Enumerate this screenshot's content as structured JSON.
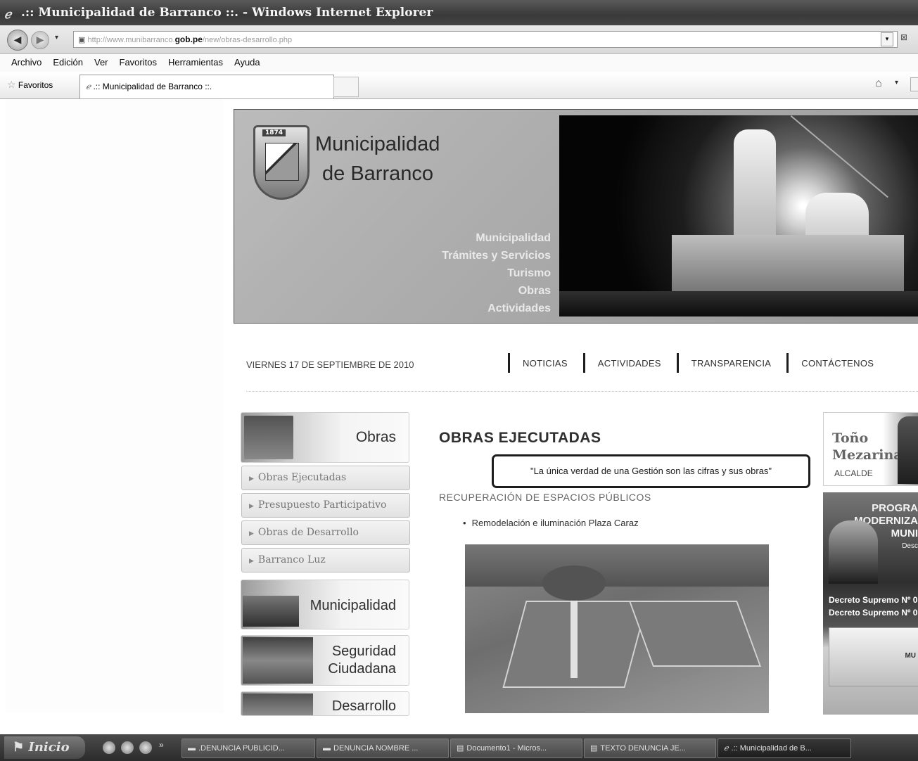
{
  "browser": {
    "window_title": ".:: Municipalidad de Barranco ::. - Windows Internet Explorer",
    "address_prefix": "http://www.munibarranco.",
    "address_domain": "gob.pe",
    "address_path": "/new/obras-desarrollo.php",
    "menu": [
      "Archivo",
      "Edición",
      "Ver",
      "Favoritos",
      "Herramientas",
      "Ayuda"
    ],
    "favorites_label": "Favoritos",
    "tab_title": ".:: Municipalidad de Barranco ::."
  },
  "site": {
    "logo_year": "1874",
    "title_line1": "Municipalidad",
    "title_line2": "de Barranco",
    "banner_menu": [
      "Municipalidad",
      "Trámites y Servicios",
      "Turismo",
      "Obras",
      "Actividades"
    ],
    "date": "VIERNES 17 DE SEPTIEMBRE DE 2010",
    "top_nav": [
      "NOTICIAS",
      "ACTIVIDADES",
      "TRANSPARENCIA",
      "CONTÁCTENOS"
    ]
  },
  "sidebar": {
    "obras_label": "Obras",
    "subitems": [
      "Obras Ejecutadas",
      "Presupuesto Participativo",
      "Obras de Desarrollo",
      "Barranco Luz"
    ],
    "municipalidad_label": "Municipalidad",
    "seguridad_line1": "Seguridad",
    "seguridad_line2": "Ciudadana",
    "desarrollo_label": "Desarrollo"
  },
  "main": {
    "title": "OBRAS EJECUTADAS",
    "quote": "\"La única verdad de una Gestión son las cifras y sus obras\"",
    "section": "RECUPERACIÓN DE ESPACIOS PÚBLICOS",
    "bullet_item": "Remodelación e iluminación Plaza Caraz"
  },
  "right": {
    "alcalde_name_line1": "Toño",
    "alcalde_name_line2": "Mezarina",
    "alcalde_role": "ALCALDE",
    "promo_title_line1": "PROGRA",
    "promo_title_line2": "MODERNIZA",
    "promo_title_line3": "MUNI",
    "promo_sub": "Desc",
    "decreto1": "Decreto Supremo Nº 0",
    "decreto2": "Decreto Supremo Nº 0",
    "promo_box_text": "MU"
  },
  "taskbar": {
    "start_label": "Inicio",
    "buttons": [
      ".DENUNCIA PUBLICID...",
      "DENUNCIA NOMBRE ...",
      "Documento1 - Micros...",
      "TEXTO DENUNCIA JE...",
      ".:: Municipalidad de B..."
    ]
  }
}
